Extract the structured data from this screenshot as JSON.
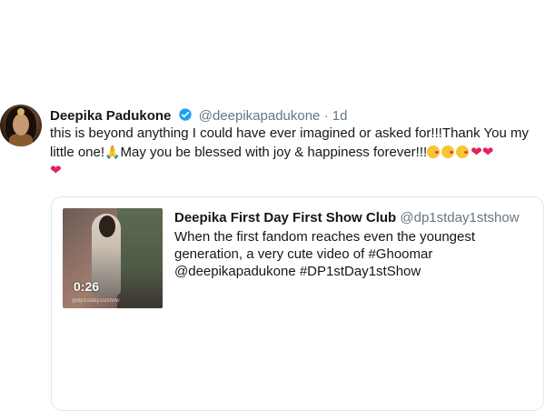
{
  "tweet": {
    "author_name": "Deepika Padukone",
    "author_handle": "@deepikapadukone",
    "separator": "·",
    "time_ago": "1d",
    "text_line1": "this is beyond anything I could have ever imagined or asked for!!!Thank You my",
    "text_line2": "little one!",
    "text_line2b": "May you be blessed with joy & happiness forever!!!",
    "emojis": [
      "folded-hands",
      "face-blowing-kiss",
      "face-blowing-kiss",
      "face-blowing-kiss",
      "red-heart",
      "red-heart",
      "red-heart"
    ],
    "heart_glyph": "❤",
    "pray_glyph": "🙏"
  },
  "quoted_tweet": {
    "author_name": "Deepika First Day First Show Club",
    "author_handle": "@dp1stday1stshow",
    "text_line1": "When the first fandom reaches even the youngest",
    "text_line2": "generation, a very cute video of #Ghoomar",
    "text_line3": "@deepikapadukone #DP1stDay1stShow",
    "video_duration": "0:26",
    "video_watermark": "@dp1stday1stshow"
  },
  "colors": {
    "verified_blue": "#1da1f2",
    "heart_red": "#e0245e",
    "secondary_text": "#657786",
    "border": "#e1e8ed"
  }
}
